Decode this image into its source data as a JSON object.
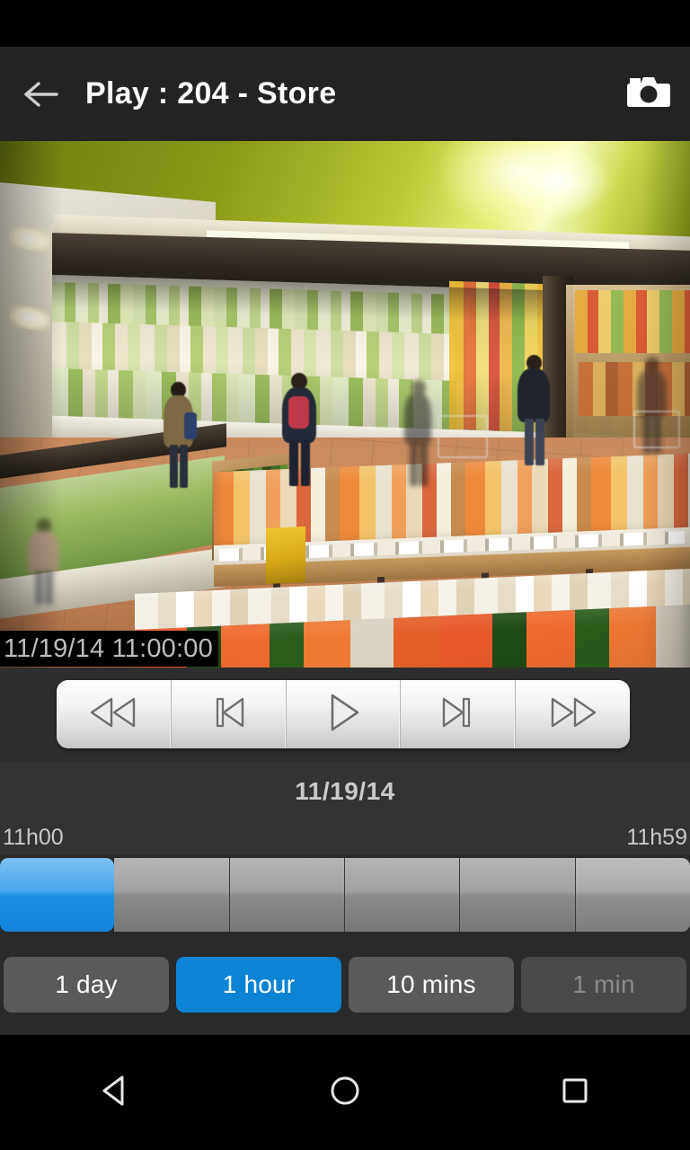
{
  "app_bar": {
    "back_icon": "arrow-left-icon",
    "title": "Play : 204 - Store",
    "snapshot_icon": "camera-icon"
  },
  "video": {
    "timestamp_overlay": "11/19/14 11:00:00",
    "scene_description": "Supermarket produce department overhead CCTV view"
  },
  "transport_controls": [
    {
      "name": "rewind",
      "icon": "rewind-icon",
      "label": "Rewind"
    },
    {
      "name": "previous",
      "icon": "skip-previous-icon",
      "label": "Previous"
    },
    {
      "name": "play",
      "icon": "play-icon",
      "label": "Play"
    },
    {
      "name": "next",
      "icon": "skip-next-icon",
      "label": "Next"
    },
    {
      "name": "fast-forward",
      "icon": "fast-forward-icon",
      "label": "Fast forward"
    }
  ],
  "timeline": {
    "date": "11/19/14",
    "start_label": "11h00",
    "end_label": "11h59",
    "segment_count": 6,
    "active_segment_index": 0,
    "active_color": "#1386dd",
    "inactive_color": "#8a8a8a"
  },
  "scale_buttons": [
    {
      "label": "1 day",
      "state": "normal"
    },
    {
      "label": "1 hour",
      "state": "active"
    },
    {
      "label": "10 mins",
      "state": "normal"
    },
    {
      "label": "1 min",
      "state": "disabled"
    }
  ],
  "nav_bar": [
    {
      "name": "back",
      "icon": "triangle-back-icon"
    },
    {
      "name": "home",
      "icon": "circle-home-icon"
    },
    {
      "name": "recents",
      "icon": "square-recents-icon"
    }
  ],
  "colors": {
    "accent": "#0b84d6",
    "app_bar_bg": "#232323",
    "panel_bg": "#2a2a2a",
    "text_primary": "#ffffff",
    "text_secondary": "#c9c9c9"
  }
}
